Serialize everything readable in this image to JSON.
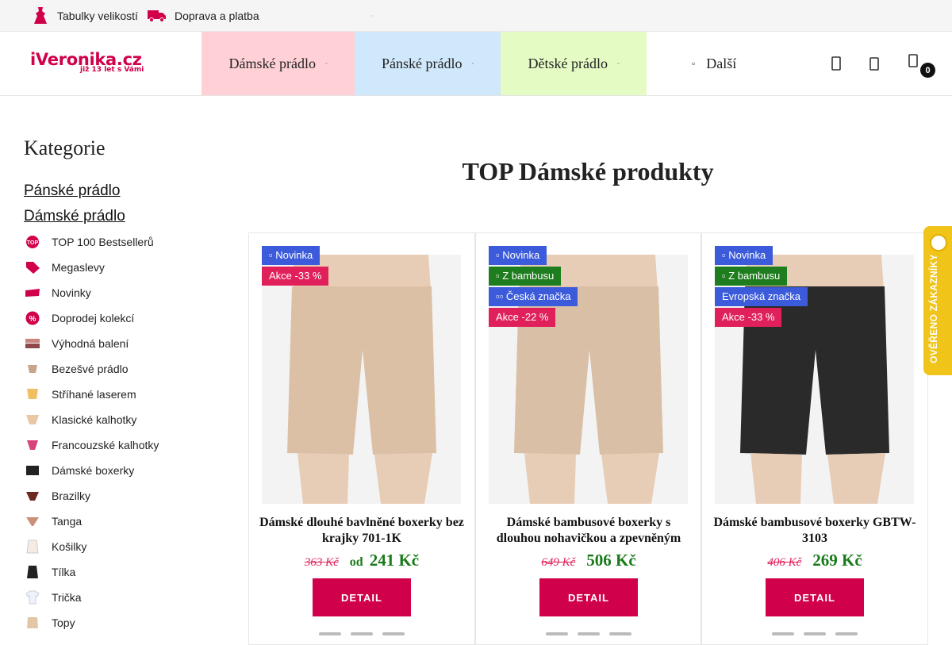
{
  "topbar": {
    "size_tables": "Tabulky velikostí",
    "shipping": "Doprava a platba",
    "mini_symbol": "▫"
  },
  "logo": {
    "name": "iVeronika.cz",
    "tagline": "již 13 let s Vámi"
  },
  "nav": {
    "items": [
      {
        "label": "Dámské prádlo",
        "caret": "▫",
        "color": "#ffd1d6"
      },
      {
        "label": "Pánské prádlo",
        "caret": "▫",
        "color": "#d0e8fb"
      },
      {
        "label": "Dětské prádlo",
        "caret": "▫",
        "color": "#e4fbc4"
      }
    ],
    "more": {
      "label": "Další",
      "symbol": "▫"
    },
    "cart_count": "0"
  },
  "sidebar": {
    "title": "Kategorie",
    "main_links": [
      "Pánské prádlo",
      "Dámské prádlo"
    ],
    "items": [
      {
        "label": "TOP 100 Bestsellerů",
        "icon": "top-badge-icon"
      },
      {
        "label": "Megaslevy",
        "icon": "tag-percent-icon"
      },
      {
        "label": "Novinky",
        "icon": "new-badge-icon"
      },
      {
        "label": "Doprodej kolekcí",
        "icon": "percent-circle-icon"
      },
      {
        "label": "Výhodná balení",
        "icon": "pack-icon"
      },
      {
        "label": "Bezešvé prádlo",
        "icon": "seamless-icon"
      },
      {
        "label": "Stříhané laserem",
        "icon": "laser-cut-icon"
      },
      {
        "label": "Klasické kalhotky",
        "icon": "briefs-icon"
      },
      {
        "label": "Francouzské kalhotky",
        "icon": "french-briefs-icon"
      },
      {
        "label": "Dámské boxerky",
        "icon": "boxers-icon"
      },
      {
        "label": "Brazilky",
        "icon": "brazilian-icon"
      },
      {
        "label": "Tanga",
        "icon": "thong-icon"
      },
      {
        "label": "Košilky",
        "icon": "camisole-icon"
      },
      {
        "label": "Tílka",
        "icon": "tank-top-icon"
      },
      {
        "label": "Trička",
        "icon": "tshirt-icon"
      },
      {
        "label": "Topy",
        "icon": "top-icon"
      }
    ]
  },
  "main": {
    "title": "TOP Dámské produkty",
    "products": [
      {
        "badges": [
          {
            "text": "▫ Novinka",
            "kind": "blue"
          },
          {
            "text": "Akce -33 %",
            "kind": "pink"
          }
        ],
        "name": "Dámské dlouhé bavlněné boxerky bez krajky 701-1K",
        "old_price": "363 Kč",
        "from": "od",
        "price": "241 Kč",
        "button": "DETAIL",
        "garment_color": "#dcc0a6"
      },
      {
        "badges": [
          {
            "text": "▫ Novinka",
            "kind": "blue"
          },
          {
            "text": "▫ Z bambusu",
            "kind": "green"
          },
          {
            "text": "▫▫ Česká značka",
            "kind": "blue"
          },
          {
            "text": "Akce -22 %",
            "kind": "pink"
          }
        ],
        "name": "Dámské bambusové boxerky s dlouhou nohavičkou a zpevněným",
        "old_price": "649 Kč",
        "from": "",
        "price": "506 Kč",
        "button": "DETAIL",
        "garment_color": "#d9bfa5"
      },
      {
        "badges": [
          {
            "text": "▫ Novinka",
            "kind": "blue"
          },
          {
            "text": "▫ Z bambusu",
            "kind": "green"
          },
          {
            "text": "Evropská značka",
            "kind": "blue"
          },
          {
            "text": "Akce -33 %",
            "kind": "pink"
          }
        ],
        "name": "Dámské bambusové boxerky GBTW-3103",
        "old_price": "406 Kč",
        "from": "",
        "price": "269 Kč",
        "button": "DETAIL",
        "garment_color": "#2a2a2a"
      }
    ]
  },
  "verified_widget": {
    "label": "OVĚŘENO ZÁKAZNÍKY"
  }
}
